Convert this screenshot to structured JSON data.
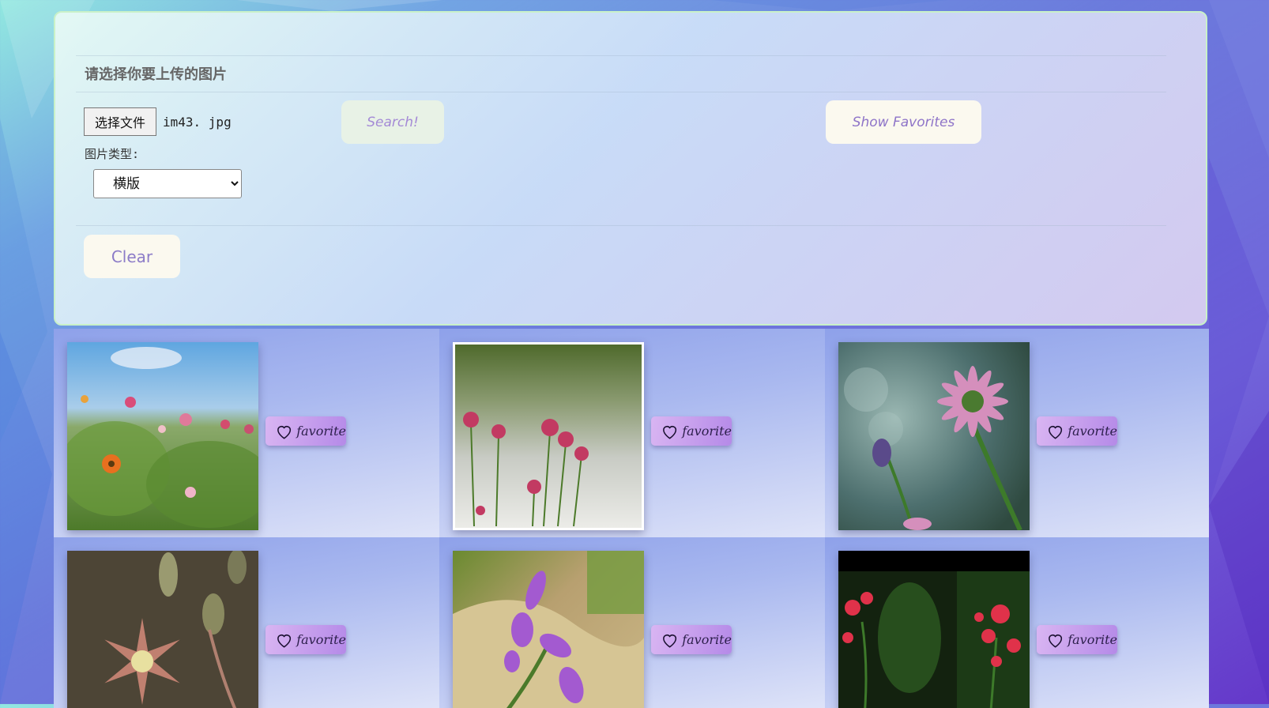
{
  "upload": {
    "title": "请选择你要上传的图片",
    "file_button_label": "选择文件",
    "file_name": "im43. jpg",
    "type_label": "图片类型:",
    "type_selected": "横版"
  },
  "buttons": {
    "search": "Search!",
    "show_favorites": "Show Favorites",
    "clear": "Clear"
  },
  "gallery": {
    "favorite_label": "favorite",
    "items": [
      {
        "name": "wildflower-field",
        "icon": "heart-outline-icon"
      },
      {
        "name": "pink-daisies",
        "icon": "heart-outline-icon"
      },
      {
        "name": "purple-daisy",
        "icon": "heart-outline-icon"
      },
      {
        "name": "star-flower",
        "icon": "heart-outline-icon"
      },
      {
        "name": "violet-flower",
        "icon": "heart-outline-icon"
      },
      {
        "name": "red-blossoms",
        "icon": "heart-outline-icon"
      }
    ]
  },
  "colors": {
    "panel_border": "#c9f1c8",
    "button_text": "#9a7ad0",
    "favorite_button": "#b58ae8"
  }
}
